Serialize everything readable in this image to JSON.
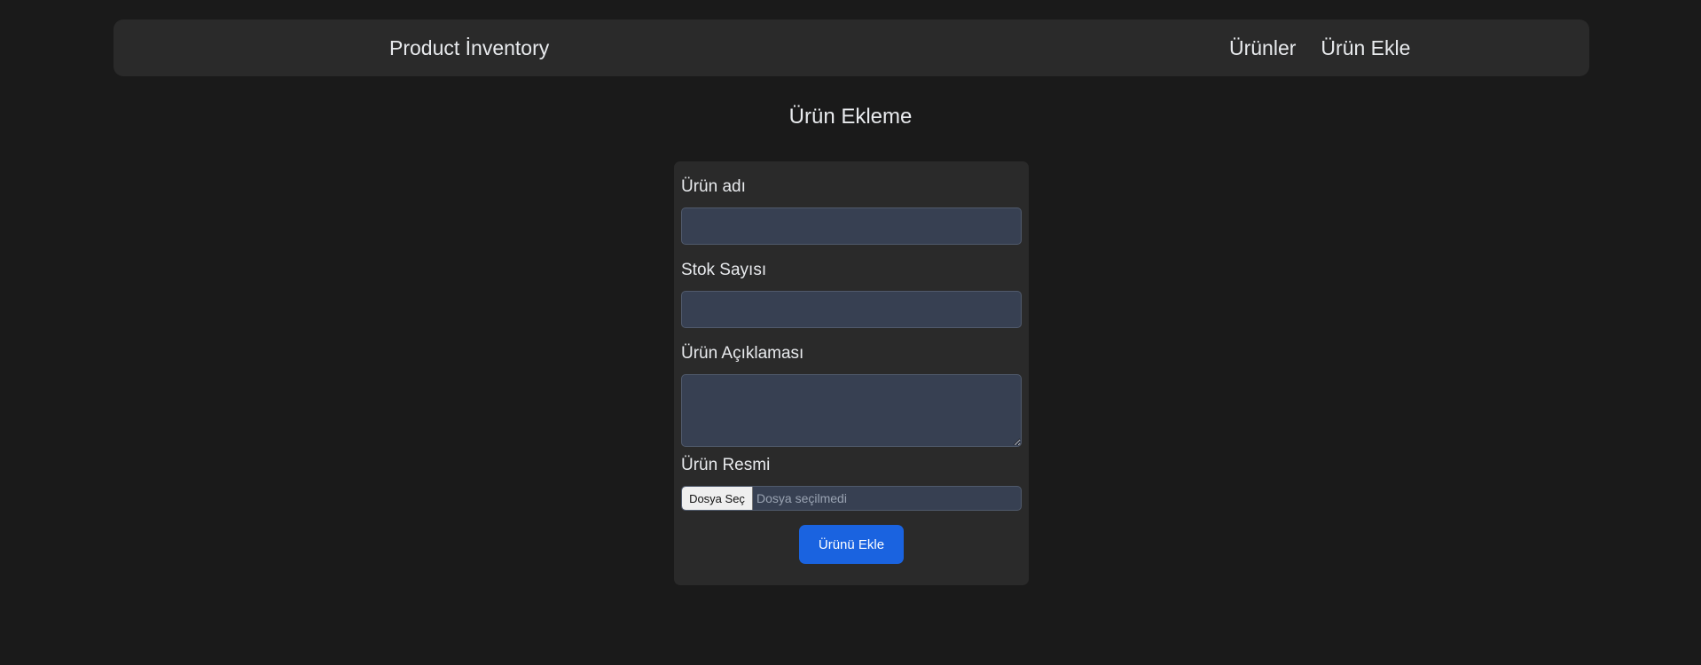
{
  "navbar": {
    "brand": "Product İnventory",
    "links": [
      {
        "label": "Ürünler"
      },
      {
        "label": "Ürün Ekle"
      }
    ]
  },
  "page": {
    "title": "Ürün Ekleme"
  },
  "form": {
    "name_label": "Ürün adı",
    "name_value": "",
    "stock_label": "Stok Sayısı",
    "stock_value": "",
    "description_label": "Ürün Açıklaması",
    "description_value": "",
    "image_label": "Ürün Resmi",
    "file_button": "Dosya Seç",
    "file_status": "Dosya seçilmedi",
    "submit_label": "Ürünü Ekle"
  }
}
